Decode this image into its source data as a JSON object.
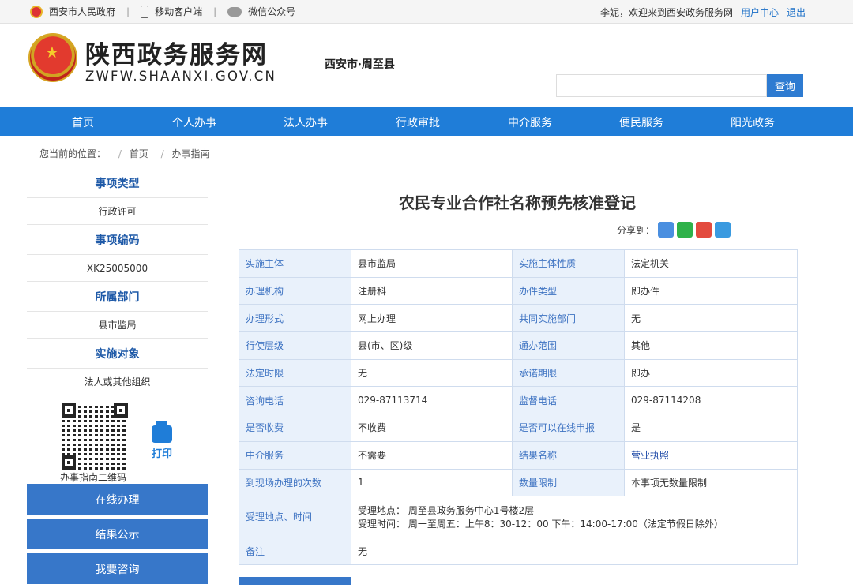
{
  "topbar": {
    "gov_link": "西安市人民政府",
    "mobile": "移动客户端",
    "wechat": "微信公众号",
    "welcome": "李妮，欢迎来到西安政务服务网",
    "user_center": "用户中心",
    "logout": "退出"
  },
  "header": {
    "title": "陕西政务服务网",
    "subtitle": "ZWFW.SHAANXI.GOV.CN",
    "region": "西安市·周至县",
    "search_placeholder": "",
    "search_button": "查询"
  },
  "nav": [
    "首页",
    "个人办事",
    "法人办事",
    "行政审批",
    "中介服务",
    "便民服务",
    "阳光政务"
  ],
  "breadcrumb": {
    "label": "您当前的位置：",
    "items": [
      "首页",
      "办事指南"
    ]
  },
  "sidebar": {
    "sections": [
      {
        "title": "事项类型",
        "value": "行政许可"
      },
      {
        "title": "事项编码",
        "value": "XK25005000"
      },
      {
        "title": "所属部门",
        "value": "县市监局"
      },
      {
        "title": "实施对象",
        "value": "法人或其他组织"
      }
    ],
    "qr_label": "办事指南二维码",
    "print_label": "打印",
    "buttons": [
      "在线办理",
      "结果公示",
      "我要咨询"
    ]
  },
  "main": {
    "title": "农民专业合作社名称预先核准登记",
    "share_label": "分享到：",
    "rows": [
      [
        "实施主体",
        "县市监局",
        "实施主体性质",
        "法定机关"
      ],
      [
        "办理机构",
        "注册科",
        "办件类型",
        "即办件"
      ],
      [
        "办理形式",
        "网上办理",
        "共同实施部门",
        "无"
      ],
      [
        "行使层级",
        "县(市、区)级",
        "通办范围",
        "其他"
      ],
      [
        "法定时限",
        "无",
        "承诺期限",
        "即办"
      ],
      [
        "咨询电话",
        "029-87113714",
        "监督电话",
        "029-87114208"
      ],
      [
        "是否收费",
        "不收费",
        "是否可以在线申报",
        "是"
      ],
      [
        "中介服务",
        "不需要",
        "结果名称",
        "营业执照"
      ],
      [
        "到现场办理的次数",
        "1",
        "数量限制",
        "本事项无数量限制"
      ]
    ],
    "location_label": "受理地点、时间",
    "location_line1": "受理地点：  周至县政务服务中心1号楼2层",
    "location_line2": "受理时间：  周一至周五：上午8：30-12：00 下午：14:00-17:00（法定节假日除外）",
    "note_label": "备注",
    "note_value": "无"
  }
}
